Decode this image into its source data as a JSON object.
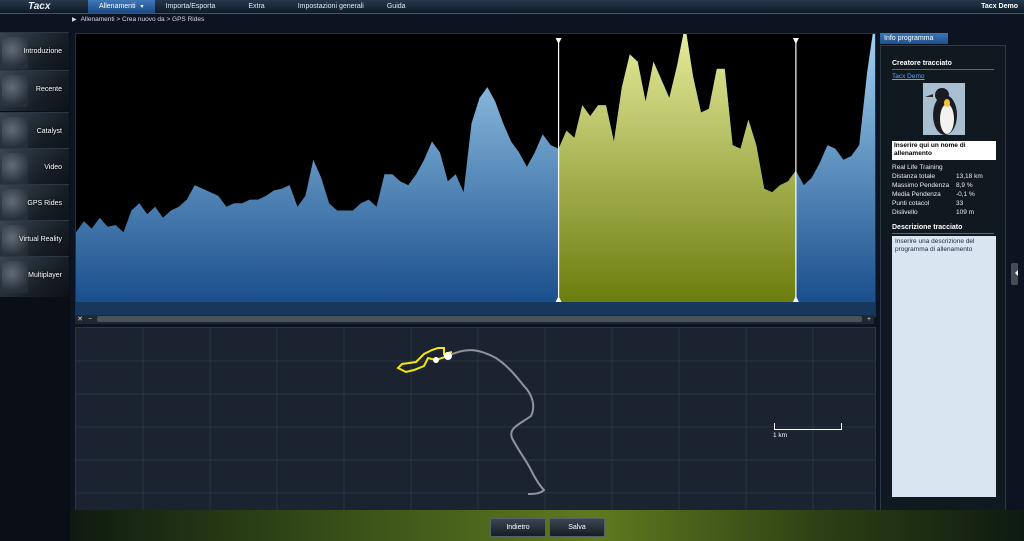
{
  "app": {
    "logo": "Tacx",
    "user": "Tacx Demo"
  },
  "menu": {
    "items": [
      "Allenamenti",
      "Importa/Esporta",
      "Extra",
      "Impostazioni generali",
      "Guida"
    ],
    "active_caret": "▾"
  },
  "breadcrumb": "Allenamenti > Crea nuovo da > GPS Rides",
  "sidebar": {
    "items": [
      {
        "label": "Introduzione"
      },
      {
        "label": "Recente"
      },
      {
        "label": "Catalyst"
      },
      {
        "label": "Video"
      },
      {
        "label": "GPS Rides"
      },
      {
        "label": "Virtual Reality"
      },
      {
        "label": "Multiplayer"
      }
    ]
  },
  "elevation_profile": {
    "note_values": "relative elevation samples along the route (0 = floor, 100 = peak)",
    "samples": [
      12,
      18,
      14,
      20,
      15,
      16,
      12,
      24,
      28,
      22,
      26,
      20,
      24,
      26,
      30,
      38,
      36,
      34,
      32,
      26,
      28,
      28,
      30,
      30,
      32,
      35,
      36,
      38,
      26,
      32,
      52,
      42,
      28,
      24,
      24,
      24,
      28,
      30,
      26,
      44,
      44,
      40,
      38,
      44,
      52,
      62,
      56,
      40,
      44,
      34,
      72,
      86,
      92,
      84,
      72,
      62,
      56,
      48,
      56,
      66,
      60,
      58,
      68,
      64,
      82,
      76,
      82,
      82,
      62,
      92,
      110,
      106,
      84,
      106,
      96,
      86,
      104,
      126,
      98,
      78,
      80,
      102,
      102,
      60,
      58,
      74,
      60,
      36,
      34,
      38,
      40,
      46,
      38,
      42,
      50,
      60,
      58,
      52,
      54,
      60,
      100,
      130
    ],
    "selection_start_fraction": 0.6,
    "selection_end_fraction": 0.9
  },
  "colors": {
    "profile_sky": "#a9d7f5",
    "profile_base": "#1a4f8c",
    "selection_top": "#e9ee9f",
    "selection_base": "#6c7d0e",
    "route_line": "#8e949a",
    "route_selected": "#f4e60c"
  },
  "map": {
    "scale_label": "1 km"
  },
  "info_panel": {
    "tab": "Info programma",
    "creator_heading": "Creatore tracciato",
    "creator_name": "Tacx Demo",
    "name_placeholder": "Inserire qui un nome di allenamento",
    "type": "Real Life Training",
    "stats": [
      {
        "label": "Distanza totale",
        "value": "13,18 km"
      },
      {
        "label": "Massimo Pendenza",
        "value": "8,9 %"
      },
      {
        "label": "Media Pendenza",
        "value": "-0,1 %"
      },
      {
        "label": "Punti cotacol",
        "value": "33"
      },
      {
        "label": "Dislivello",
        "value": "109 m"
      }
    ],
    "description_heading": "Descrizione tracciato",
    "description_placeholder": "Inserire una descrizione del programma di allenamento"
  },
  "buttons": {
    "back": "Indietro",
    "save": "Salva"
  }
}
